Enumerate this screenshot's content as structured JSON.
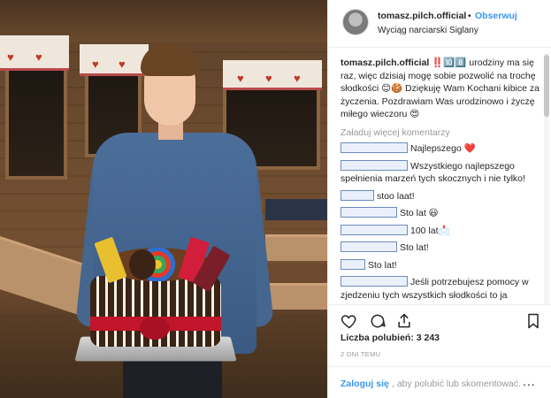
{
  "header": {
    "username": "tomasz.pilch.official",
    "separator": "•",
    "follow_label": "Obserwuj",
    "location": "Wyciąg narciarski Siglany"
  },
  "caption": {
    "username": "tomasz.pilch.official",
    "text": "‼️🔟8️⃣ urodziny ma się raz, więc dzisiaj mogę sobie pozwolić na trochę słodkości 😊🍪 Dziękuję Wam Kochani kibice za życzenia. Pozdrawiam Was urodzinowo i życzę miłego wieczoru 😍"
  },
  "load_more_label": "Załaduj więcej komentarzy",
  "comments": [
    {
      "text": "Najlepszego ❤️"
    },
    {
      "text": "Wszystkiego najlepszego spełnienia marzeń tych skocznych i nie tylko!"
    },
    {
      "text": "stoo laat!"
    },
    {
      "text": "Sto lat 😃"
    },
    {
      "text": "100 lat📩"
    },
    {
      "text": "Sto lat!"
    },
    {
      "text": "Sto lat!"
    },
    {
      "text": "Jeśli potrzebujesz pomocy w zjedzeniu tych wszystkich słodkości to ja"
    }
  ],
  "icons": {
    "like": "heart-outline-icon",
    "comment": "comment-bubble-icon",
    "share": "share-icon",
    "save": "bookmark-icon"
  },
  "likes_label": "Liczba polubień: 3 243",
  "date_label": "2 DNI TEMU",
  "footer": {
    "login_label": "Zaloguj się",
    "rest_label": ", aby polubić lub skomentować.",
    "more_label": "..."
  },
  "colors": {
    "link_blue": "#3897f0",
    "muted": "#999999",
    "text": "#262626",
    "border": "#efefef"
  }
}
